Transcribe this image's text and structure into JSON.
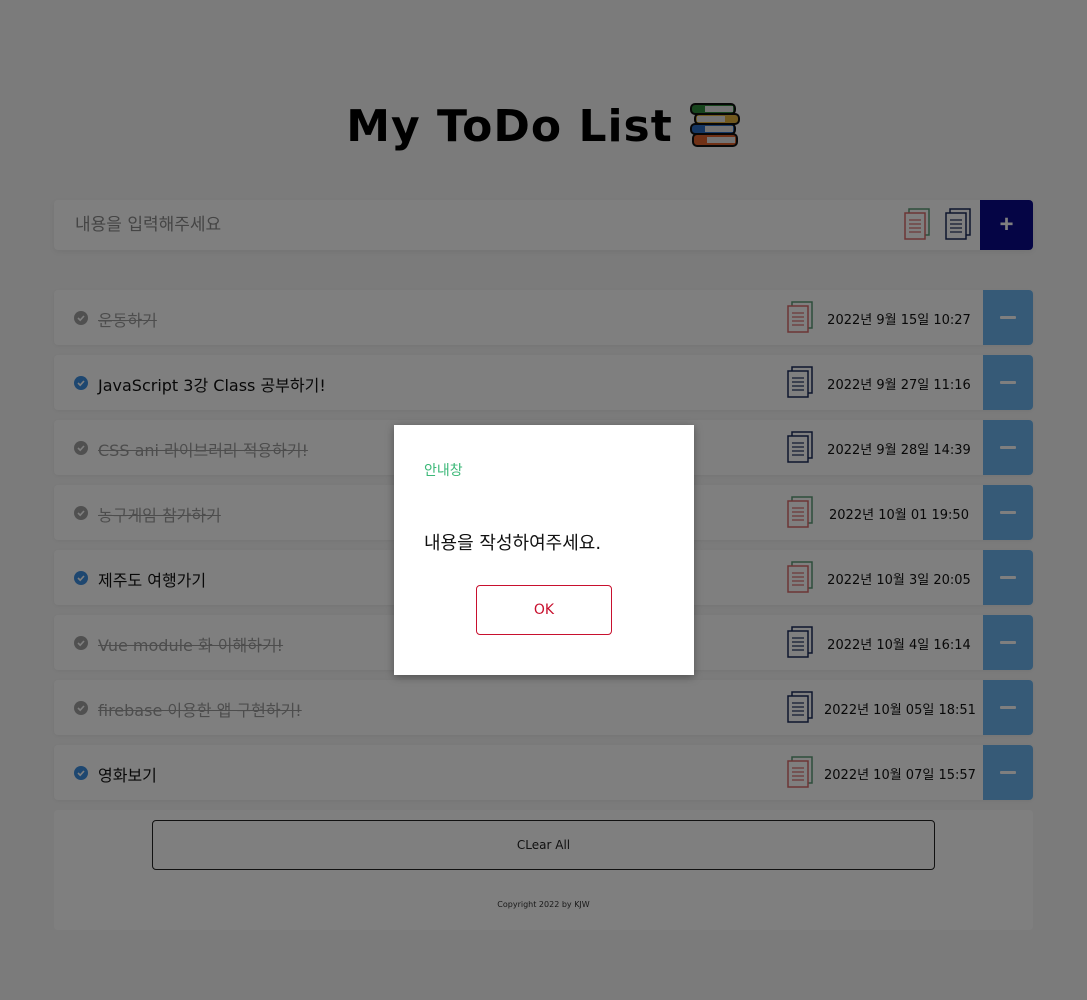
{
  "header": {
    "title": "My ToDo List",
    "title_icon": "books-icon"
  },
  "input": {
    "placeholder": "내용을 입력해주세요",
    "value": "",
    "add_label": "+"
  },
  "todos": [
    {
      "text": "운동하기",
      "done": true,
      "date": "2022년 9월 15일 10:27",
      "memo_icon": "memo-red-icon"
    },
    {
      "text": "JavaScript 3강 Class 공부하기!",
      "done": false,
      "date": "2022년 9월 27일 11:16",
      "memo_icon": "memo-navy-icon"
    },
    {
      "text": "CSS ani 라이브러리 적용하기!",
      "done": true,
      "date": "2022년 9월 28일 14:39",
      "memo_icon": "memo-navy-icon"
    },
    {
      "text": "농구게임 참가하기",
      "done": true,
      "date": "2022년 10월 01 19:50",
      "memo_icon": "memo-red-icon"
    },
    {
      "text": "제주도 여행가기",
      "done": false,
      "date": "2022년 10월 3일 20:05",
      "memo_icon": "memo-red-icon"
    },
    {
      "text": "Vue module 화 이해하기!",
      "done": true,
      "date": "2022년 10월 4일 16:14",
      "memo_icon": "memo-navy-icon"
    },
    {
      "text": "firebase 이용한 앱 구현하기!",
      "done": true,
      "date": "2022년 10월 05일 18:51",
      "memo_icon": "memo-navy-icon"
    },
    {
      "text": "영화보기",
      "done": false,
      "date": "2022년 10월 07일 15:57",
      "memo_icon": "memo-red-icon"
    }
  ],
  "footer": {
    "clear_label": "CLear All",
    "copyright": "Copyright 2022 by KJW"
  },
  "modal": {
    "title": "안내창",
    "message": "내용을 작성하여주세요.",
    "ok_label": "OK"
  },
  "colors": {
    "add_button": "#0a0a8a",
    "remove_button": "#6cb5ee",
    "check_active": "#3d8ee0",
    "check_done": "#a0a0a0",
    "modal_title": "#3cb878",
    "ok_button": "#c8102e"
  }
}
